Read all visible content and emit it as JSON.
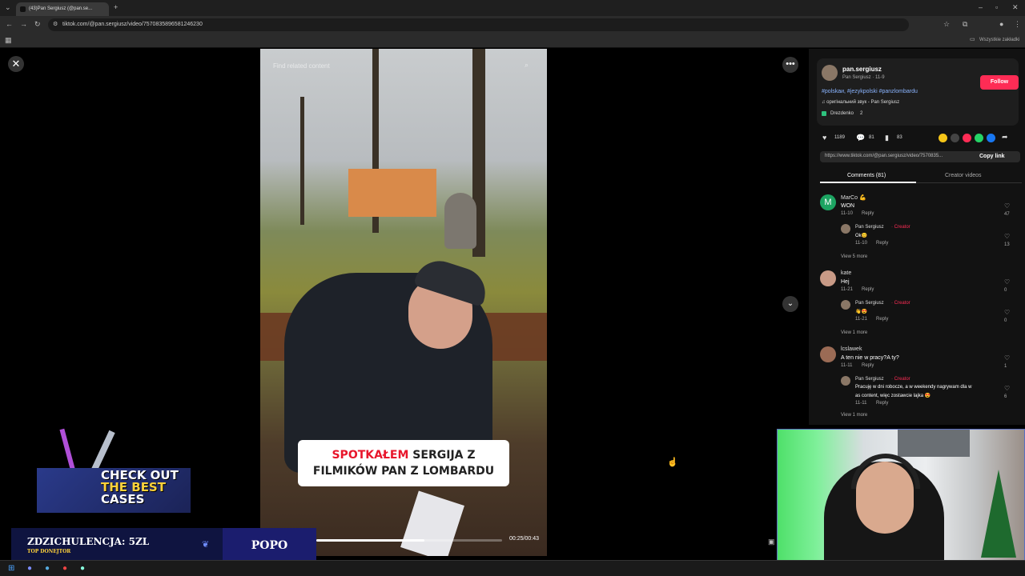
{
  "browser": {
    "tab_title": "(43)Pan Sergiusz (@pan.se...",
    "url": "tiktok.com/@pan.sergiusz/video/7570835896581246230",
    "bookmarks_all": "Wszystkie zakładki"
  },
  "video": {
    "search_placeholder": "Find related content",
    "caption_line1_red": "SPOTKAŁEM",
    "caption_line1_rest": " SERGIJA Z",
    "caption_line2": "FILMIKÓW PAN Z LOMBARDU",
    "time": "00:25/00:43",
    "progress": 0.58
  },
  "panel": {
    "username": "pan.sergiusz",
    "display_meta": "Pan Sergiusz · 11-9",
    "follow_label": "Follow",
    "hashtags": "#polskaи, #jezykpolski #panzlombardu",
    "sound": "♫  оригінальний звук - Pan Sergiusz",
    "location": "Drezdenko",
    "location_count": "2",
    "likes": "1189",
    "comments_count": "81",
    "saves": "83",
    "link": "https://www.tiktok.com/@pan.sergiusz/video/7570835...",
    "copy_link": "Copy link",
    "tab_comments": "Comments (81)",
    "tab_creator": "Creator videos"
  },
  "comments": [
    {
      "author": "MarCo 💪",
      "text": "WON",
      "date": "11-10",
      "reply": "Reply",
      "likes": "47",
      "sub_author": "Pan Sergiusz",
      "sub_tag": "· Creator",
      "sub_text": "Ok😊",
      "sub_date": "11-10",
      "sub_likes": "13",
      "more": "View 5 more"
    },
    {
      "author": "kate",
      "text": "Hej",
      "date": "11-21",
      "reply": "Reply",
      "likes": "0",
      "sub_author": "Pan Sergiusz",
      "sub_tag": "· Creator",
      "sub_text": "👋😍",
      "sub_date": "11-21",
      "sub_likes": "0",
      "more": "View 1 more"
    },
    {
      "author": "lcslawek",
      "text": "A ten nie w pracy?A ty?",
      "date": "11-11",
      "reply": "Reply",
      "likes": "1",
      "sub_author": "Pan Sergiusz",
      "sub_tag": "· Creator",
      "sub_text": "Pracuję w dni robocze, a w weekendy nagrywam dla w",
      "sub_text2": "as content, więc zostawcie lajka 😍",
      "sub_date": "11-11",
      "sub_likes": "6",
      "more": "View 1 more"
    }
  ],
  "overlay": {
    "promo_line1": "CHECK OUT",
    "promo_line2": "THE BEST",
    "promo_line3": "CASES",
    "donor_name": "ZDZICHULENCJA: 5ZL",
    "donor_sub": "TOP DONEJTOR",
    "donor_right": "POPO"
  },
  "colors": {
    "accent": "#fe2c55",
    "panel_bg": "#121212"
  }
}
